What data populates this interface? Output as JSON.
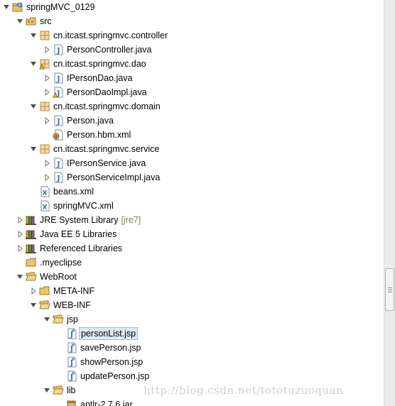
{
  "tree": [
    {
      "label": "springMVC_0129",
      "depth": 0,
      "expanded": true,
      "icon": "project",
      "name": "project-springmvc-0129"
    },
    {
      "label": "src",
      "depth": 1,
      "expanded": true,
      "icon": "source-folder",
      "name": "folder-src"
    },
    {
      "label": "cn.itcast.springmvc.controller",
      "depth": 2,
      "expanded": true,
      "icon": "package",
      "name": "package-controller"
    },
    {
      "label": "PersonController.java",
      "depth": 3,
      "expanded": false,
      "icon": "java",
      "name": "file-personcontroller-java"
    },
    {
      "label": "cn.itcast.springmvc.dao",
      "depth": 2,
      "expanded": true,
      "icon": "package-warn",
      "name": "package-dao"
    },
    {
      "label": "IPersonDao.java",
      "depth": 3,
      "expanded": false,
      "icon": "java",
      "name": "file-ipersondao-java"
    },
    {
      "label": "PersonDaoImpl.java",
      "depth": 3,
      "expanded": false,
      "icon": "java-warn",
      "name": "file-persondaoimpl-java"
    },
    {
      "label": "cn.itcast.springmvc.domain",
      "depth": 2,
      "expanded": true,
      "icon": "package",
      "name": "package-domain"
    },
    {
      "label": "Person.java",
      "depth": 3,
      "expanded": false,
      "icon": "java",
      "name": "file-person-java"
    },
    {
      "label": "Person.hbm.xml",
      "depth": 3,
      "icon": "hbm",
      "name": "file-person-hbm-xml"
    },
    {
      "label": "cn.itcast.springmvc.service",
      "depth": 2,
      "expanded": true,
      "icon": "package",
      "name": "package-service"
    },
    {
      "label": "IPersonService.java",
      "depth": 3,
      "expanded": false,
      "icon": "java",
      "name": "file-ipersonservice-java"
    },
    {
      "label": "PersonServiceImpl.java",
      "depth": 3,
      "expanded": false,
      "icon": "java",
      "name": "file-personserviceimpl-java"
    },
    {
      "label": "beans.xml",
      "depth": 2,
      "icon": "xml",
      "name": "file-beans-xml"
    },
    {
      "label": "springMVC.xml",
      "depth": 2,
      "icon": "xml",
      "name": "file-springmvc-xml"
    },
    {
      "label": "JRE System Library",
      "suffix": "[jre7]",
      "depth": 1,
      "expanded": false,
      "icon": "library",
      "name": "library-jre-system"
    },
    {
      "label": "Java EE 5 Libraries",
      "depth": 1,
      "expanded": false,
      "icon": "library",
      "name": "library-javaee5"
    },
    {
      "label": "Referenced Libraries",
      "depth": 1,
      "expanded": false,
      "icon": "library",
      "name": "library-referenced"
    },
    {
      "label": ".myeclipse",
      "depth": 1,
      "icon": "folder",
      "name": "folder-myeclipse"
    },
    {
      "label": "WebRoot",
      "depth": 1,
      "expanded": true,
      "icon": "folder-open",
      "name": "folder-webroot"
    },
    {
      "label": "META-INF",
      "depth": 2,
      "expanded": false,
      "icon": "folder",
      "name": "folder-meta-inf"
    },
    {
      "label": "WEB-INF",
      "depth": 2,
      "expanded": true,
      "icon": "folder-open",
      "name": "folder-web-inf"
    },
    {
      "label": "jsp",
      "depth": 3,
      "expanded": true,
      "icon": "folder-open",
      "name": "folder-jsp"
    },
    {
      "label": "personList.jsp",
      "depth": 4,
      "icon": "jsp",
      "selected": true,
      "name": "file-personlist-jsp"
    },
    {
      "label": "savePerson.jsp",
      "depth": 4,
      "icon": "jsp",
      "name": "file-saveperson-jsp"
    },
    {
      "label": "showPerson.jsp",
      "depth": 4,
      "icon": "jsp",
      "name": "file-showperson-jsp"
    },
    {
      "label": "updatePerson.jsp",
      "depth": 4,
      "icon": "jsp",
      "name": "file-updateperson-jsp"
    },
    {
      "label": "lib",
      "depth": 3,
      "expanded": true,
      "icon": "folder-open",
      "name": "folder-lib"
    },
    {
      "label": "antlr-2.7.6.jar",
      "depth": 4,
      "icon": "jar",
      "name": "file-antlr-jar"
    }
  ],
  "watermark": "http://blog.csdn.net/tototuzuoquan",
  "colors": {
    "selection": "#dde8f5",
    "folder": "#e8c46a",
    "package": "#c8893a",
    "java": "#3e6db5",
    "decorator_suffix": "#8b7e5a"
  }
}
